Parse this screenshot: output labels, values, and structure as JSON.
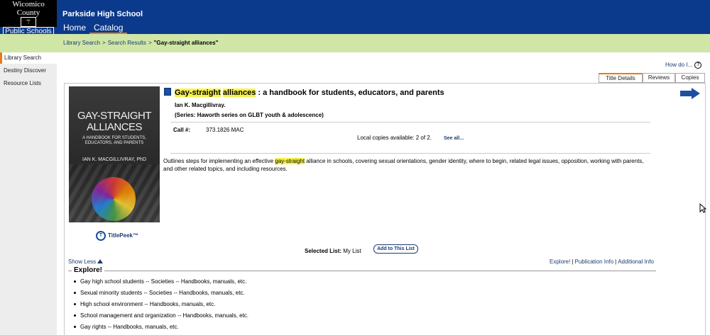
{
  "header": {
    "logo_line1": "Wicomico County",
    "logo_line2": "Public Schools",
    "school_name": "Parkside High School",
    "nav": [
      {
        "label": "Home"
      },
      {
        "label": "Catalog"
      }
    ]
  },
  "breadcrumb": {
    "items": [
      "Library Search",
      "Search Results",
      "\"Gay-straight alliances\""
    ]
  },
  "sidebar": {
    "items": [
      {
        "label": "Library Search",
        "active": true
      },
      {
        "label": "Destiny Discover"
      },
      {
        "label": "Resource Lists"
      }
    ]
  },
  "help": {
    "label": "How do I...",
    "icon": "help-icon"
  },
  "tabs": [
    {
      "label": "Title Details",
      "active": true
    },
    {
      "label": "Reviews"
    },
    {
      "label": "Copies"
    }
  ],
  "cover": {
    "title": "GAY-STRAIGHT ALLIANCES",
    "subtitle": "A HANDBOOK FOR STUDENTS, EDUCATORS, AND PARENTS",
    "author": "IAN K. MACGILLIVRAY, PhD"
  },
  "titlepeek": {
    "label": "TitlePeek™"
  },
  "record": {
    "title_hl1": "Gay-straight",
    "title_hl2": "alliances",
    "title_rest": " : a handbook for students, educators, and parents",
    "author": "Ian K. Macgillivray.",
    "series": "(Series: Haworth series on GLBT youth & adolescence)",
    "call_label": "Call #:",
    "call_number": "373.1826 MAC",
    "local_copies": "Local copies available: 2 of 2.",
    "see_all": "See all...",
    "summary_pre": "Outlines steps for implementing an effective ",
    "summary_hl": "gay-straight",
    "summary_post": " alliance in schools, covering sexual orientations, gender identity, where to begin, related legal issues, opposition, working with parents, and other related topics, and including resources."
  },
  "list": {
    "selected_label": "Selected List:",
    "selected_value": "My List",
    "add_button": "Add to This List"
  },
  "show_less": "Show Less",
  "section_links": [
    "Explore!",
    "Publication Info",
    "Additional Info"
  ],
  "explore": {
    "heading": "Explore!",
    "items": [
      "Gay high school students -- Societies -- Handbooks, manuals, etc.",
      "Sexual minority students -- Societies -- Handbooks, manuals, etc.",
      "High school environment -- Handbooks, manuals, etc.",
      "School management and organization -- Handbooks, manuals, etc.",
      "Gay rights -- Handbooks, manuals, etc."
    ]
  },
  "colors": {
    "header_blue": "#0b3a8c",
    "breadcrumb_green": "#cfe6a6",
    "accent_orange": "#e77b1a",
    "highlight_yellow": "#f7f24a",
    "link_blue": "#1c3b6f"
  }
}
